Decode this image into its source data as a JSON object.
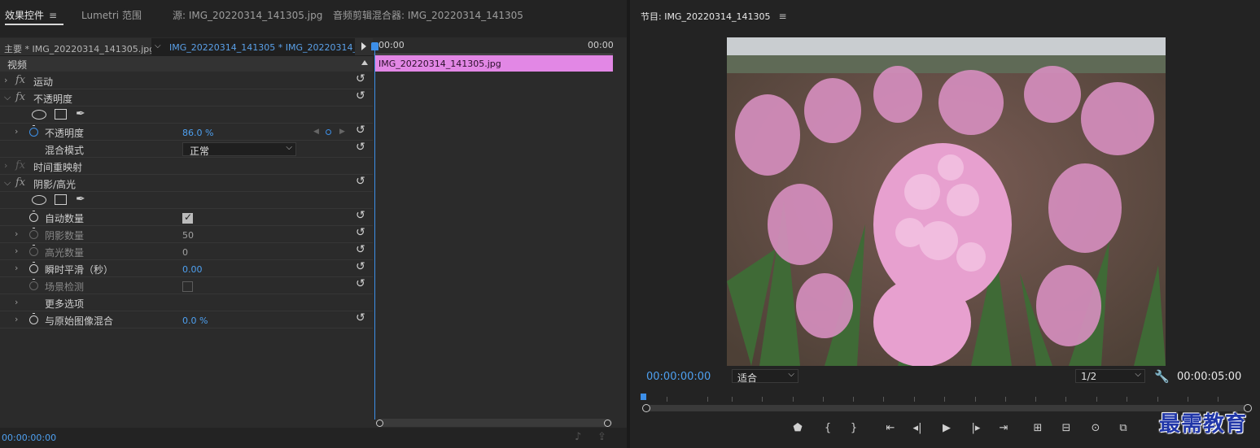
{
  "tabs": [
    {
      "label": "效果控件"
    },
    {
      "label": "Lumetri 范围"
    },
    {
      "label": "源: IMG_20220314_141305.jpg"
    },
    {
      "label": "音频剪辑混合器: IMG_20220314_141305"
    }
  ],
  "menu_icon": "≡",
  "source": {
    "master": "主要 * IMG_20220314_141305.jpg",
    "clip": "IMG_20220314_141305 * IMG_20220314_..."
  },
  "section": "视频",
  "effects": {
    "motion": "运动",
    "opacity": {
      "name": "不透明度",
      "prop_label": "不透明度",
      "value": "86.0 %",
      "blend_label": "混合模式",
      "blend_value": "正常"
    },
    "time_remap": "时间重映射",
    "shadow_highlight": {
      "name": "阴影/高光",
      "auto_amount": "自动数量",
      "shadow_amount": "阴影数量",
      "shadow_value": "50",
      "highlight_amount": "高光数量",
      "highlight_value": "0",
      "temporal_smoothing": "瞬时平滑（秒）",
      "temporal_value": "0.00",
      "scene_detect": "场景检测",
      "more_options": "更多选项",
      "blend_original": "与原始图像混合",
      "blend_original_value": "0.0 %"
    }
  },
  "timeline": {
    "start": "00:00",
    "end": "00:00",
    "clip": "IMG_20220314_141305.jpg"
  },
  "bottom_timecode": "00:00:00:00",
  "program": {
    "title": "节目: IMG_20220314_141305",
    "timecode": "00:00:00:00",
    "fit": "适合",
    "resolution": "1/2",
    "duration": "00:00:05:00"
  },
  "watermark": "最需教育",
  "colors": {
    "accent": "#3d8fe8",
    "clip": "#e287e5",
    "panel": "#2b2b2b"
  }
}
